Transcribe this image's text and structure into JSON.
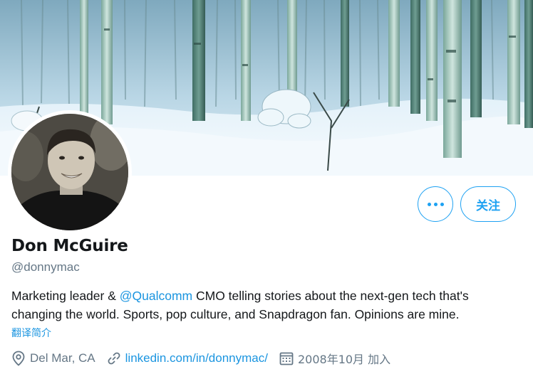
{
  "profile": {
    "display_name": "Don McGuire",
    "handle": "@donnymac",
    "bio": {
      "before": "Marketing leader & ",
      "mention": "@Qualcomm",
      "after": " CMO telling stories about the next-gen tech that's changing the world. Sports, pop culture, and Snapdragon fan. Opinions are mine."
    },
    "translate_label": "翻译简介",
    "location": "Del Mar, CA",
    "website": "linkedin.com/in/donnymac/",
    "joined": "2008年10月 加入"
  },
  "actions": {
    "follow_label": "关注"
  },
  "icons": {
    "more": "more-horizontal-icon",
    "location": "location-pin-icon",
    "link": "link-icon",
    "calendar": "calendar-icon"
  },
  "colors": {
    "accent": "#1da1f2",
    "link": "#1b95e0",
    "text_primary": "#14171a",
    "text_secondary": "#657786"
  }
}
